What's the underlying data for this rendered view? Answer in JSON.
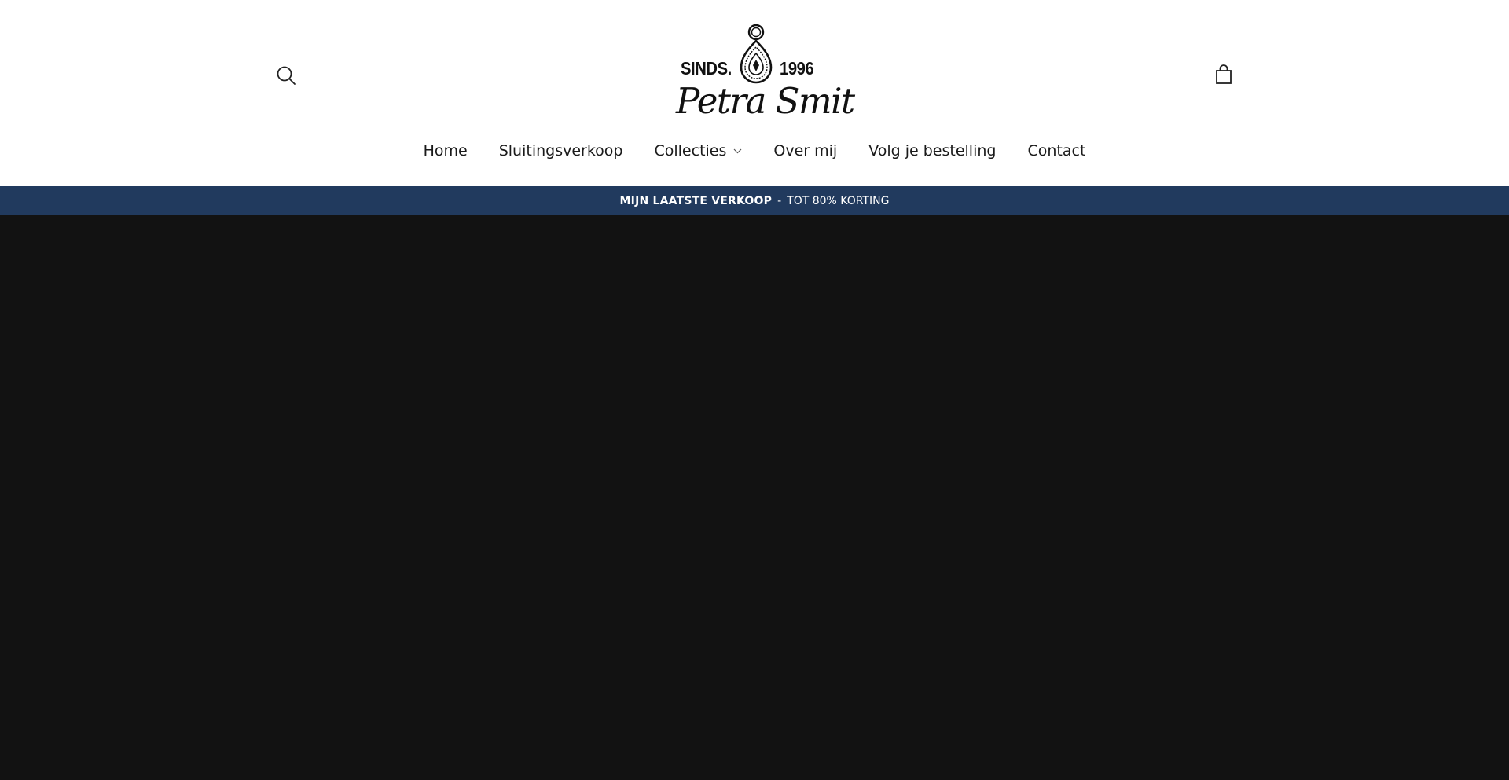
{
  "header": {
    "logo": {
      "since_label": "SINDS.",
      "year": "1996",
      "brand_name": "Petra Smit"
    },
    "search_icon": "search-icon",
    "cart_icon": "shopping-bag-icon"
  },
  "nav": {
    "items": [
      {
        "label": "Home"
      },
      {
        "label": "Sluitingsverkoop"
      },
      {
        "label": "Collecties",
        "has_dropdown": true,
        "icon": "chevron-down-icon"
      },
      {
        "label": "Over mij"
      },
      {
        "label": "Volg je bestelling"
      },
      {
        "label": "Contact"
      }
    ]
  },
  "announcement": {
    "highlight": "MIJN LAATSTE VERKOOP",
    "separator": "-",
    "text": "TOT 80% KORTING"
  },
  "colors": {
    "announcement_bg": "#213a5e",
    "hero_bg": "#121212",
    "text": "#1a1a1a"
  }
}
